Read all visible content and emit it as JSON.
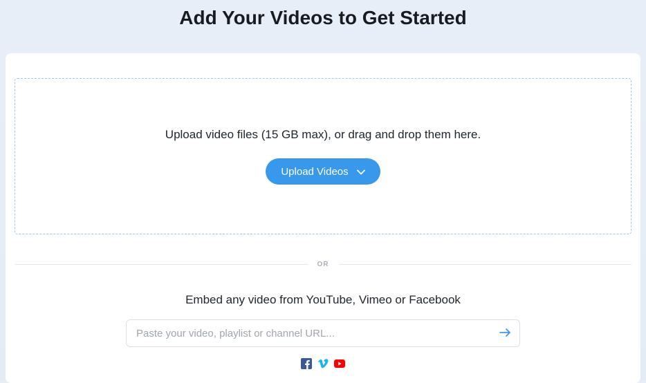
{
  "page_title": "Add Your Videos to Get Started",
  "dropzone": {
    "instruction": "Upload video files (15 GB max), or drag and drop them here.",
    "upload_button_label": "Upload Videos"
  },
  "divider": {
    "label": "OR"
  },
  "embed": {
    "instruction": "Embed any video from YouTube, Vimeo or Facebook",
    "url_placeholder": "Paste your video, playlist or channel URL..."
  },
  "colors": {
    "accent": "#3899ec",
    "facebook": "#3b5998",
    "vimeo": "#1ab7ea",
    "youtube": "#ff0000"
  }
}
